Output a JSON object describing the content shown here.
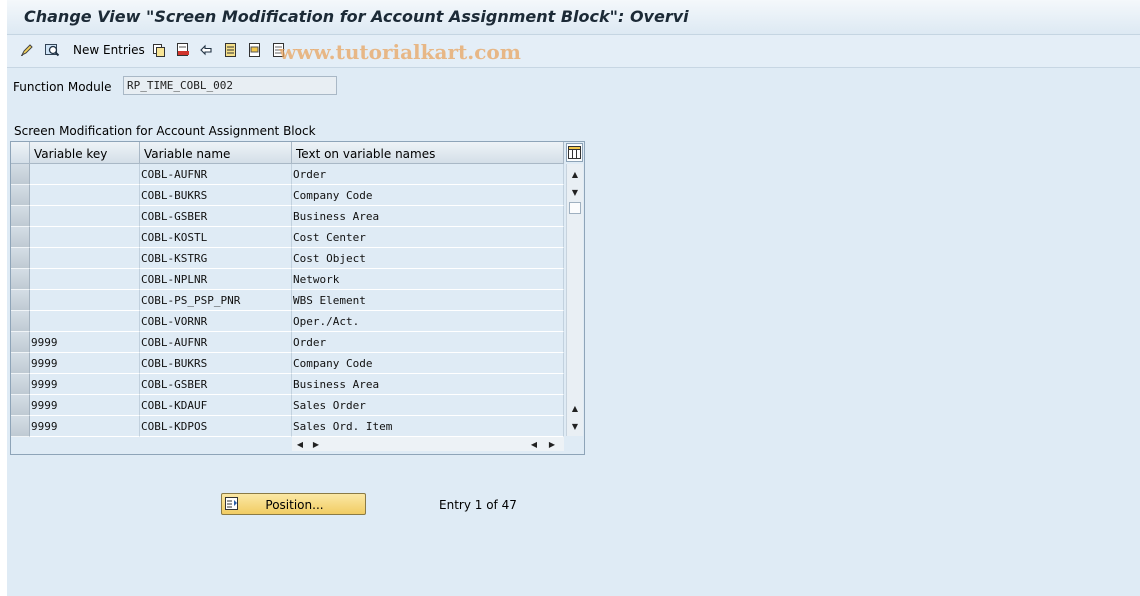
{
  "window": {
    "title": "Change View \"Screen Modification for Account Assignment Block\": Overvi"
  },
  "toolbar": {
    "icons": [
      "edit-pencil-icon",
      "display-icon",
      "copy-icon",
      "delete-icon",
      "undo-icon",
      "select-all-icon",
      "select-block-icon",
      "deselect-all-icon"
    ],
    "new_entries_label": "New Entries"
  },
  "watermark": "www.tutorialkart.com",
  "form": {
    "function_module_label": "Function Module",
    "function_module_value": "RP_TIME_COBL_002"
  },
  "table": {
    "title": "Screen Modification for Account Assignment Block",
    "columns": [
      "Variable key",
      "Variable name",
      "Text on variable names"
    ],
    "rows": [
      [
        "",
        "COBL-AUFNR",
        "Order"
      ],
      [
        "",
        "COBL-BUKRS",
        "Company Code"
      ],
      [
        "",
        "COBL-GSBER",
        "Business Area"
      ],
      [
        "",
        "COBL-KOSTL",
        "Cost Center"
      ],
      [
        "",
        "COBL-KSTRG",
        "Cost Object"
      ],
      [
        "",
        "COBL-NPLNR",
        "Network"
      ],
      [
        "",
        "COBL-PS_PSP_PNR",
        "WBS Element"
      ],
      [
        "",
        "COBL-VORNR",
        "Oper./Act."
      ],
      [
        "9999",
        "COBL-AUFNR",
        "Order"
      ],
      [
        "9999",
        "COBL-BUKRS",
        "Company Code"
      ],
      [
        "9999",
        "COBL-GSBER",
        "Business Area"
      ],
      [
        "9999",
        "COBL-KDAUF",
        "Sales Order"
      ],
      [
        "9999",
        "COBL-KDPOS",
        "Sales Ord. Item"
      ]
    ]
  },
  "footer": {
    "position_button_label": "Position...",
    "entry_info": "Entry 1 of 47"
  },
  "colors": {
    "background": "#dfebf5",
    "title_text": "#1c2a36",
    "button_yellow": "#f1cc63",
    "watermark": "#e8a460"
  }
}
